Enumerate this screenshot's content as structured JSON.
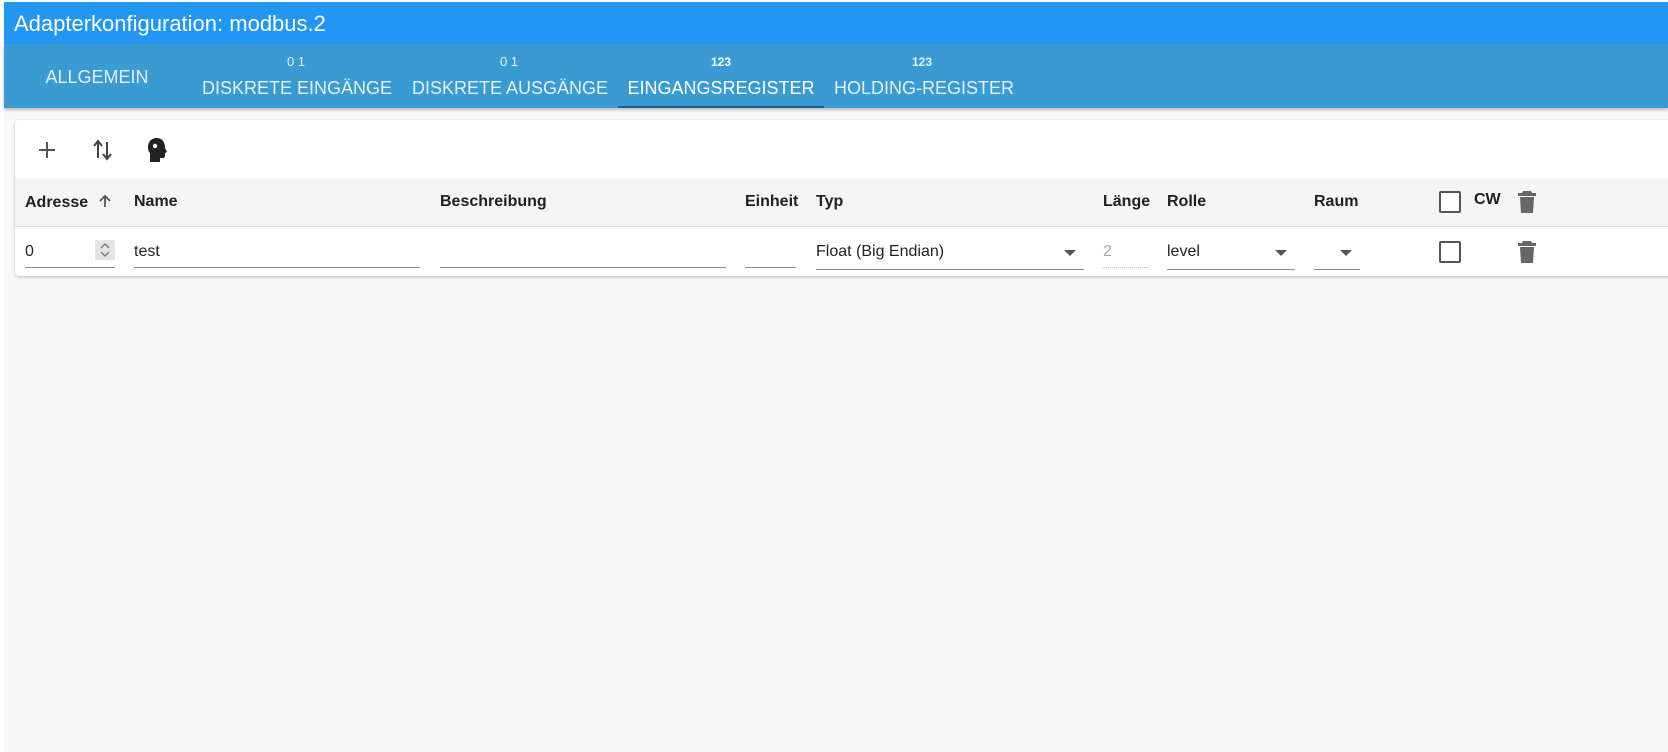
{
  "window": {
    "title": "Adapterkonfiguration: modbus.2"
  },
  "tabs": [
    {
      "icon": "",
      "label": "ALLGEMEIN"
    },
    {
      "icon": "0 1",
      "label": "DISKRETE EINGÄNGE"
    },
    {
      "icon": "0 1",
      "label": "DISKRETE AUSGÄNGE"
    },
    {
      "icon": "123",
      "label": "EINGANGSREGISTER",
      "active": true
    },
    {
      "icon": "123",
      "label": "HOLDING-REGISTER"
    }
  ],
  "toolbar": {
    "add_icon": "plus-icon",
    "sort_icon": "swap-vertical-icon",
    "import_icon": "head-icon"
  },
  "table": {
    "headers": {
      "address": "Adresse",
      "name": "Name",
      "description": "Beschreibung",
      "unit": "Einheit",
      "type": "Typ",
      "length": "Länge",
      "role": "Rolle",
      "room": "Raum",
      "cw": "CW"
    },
    "rows": [
      {
        "address": "0",
        "name": "test",
        "description": "",
        "unit": "",
        "type": "Float (Big Endian)",
        "length": "2",
        "role": "level",
        "room": ""
      }
    ]
  },
  "colors": {
    "titlebar": "#2196f3",
    "tabbar": "#3a9bd3",
    "background": "#f9f9f9"
  }
}
